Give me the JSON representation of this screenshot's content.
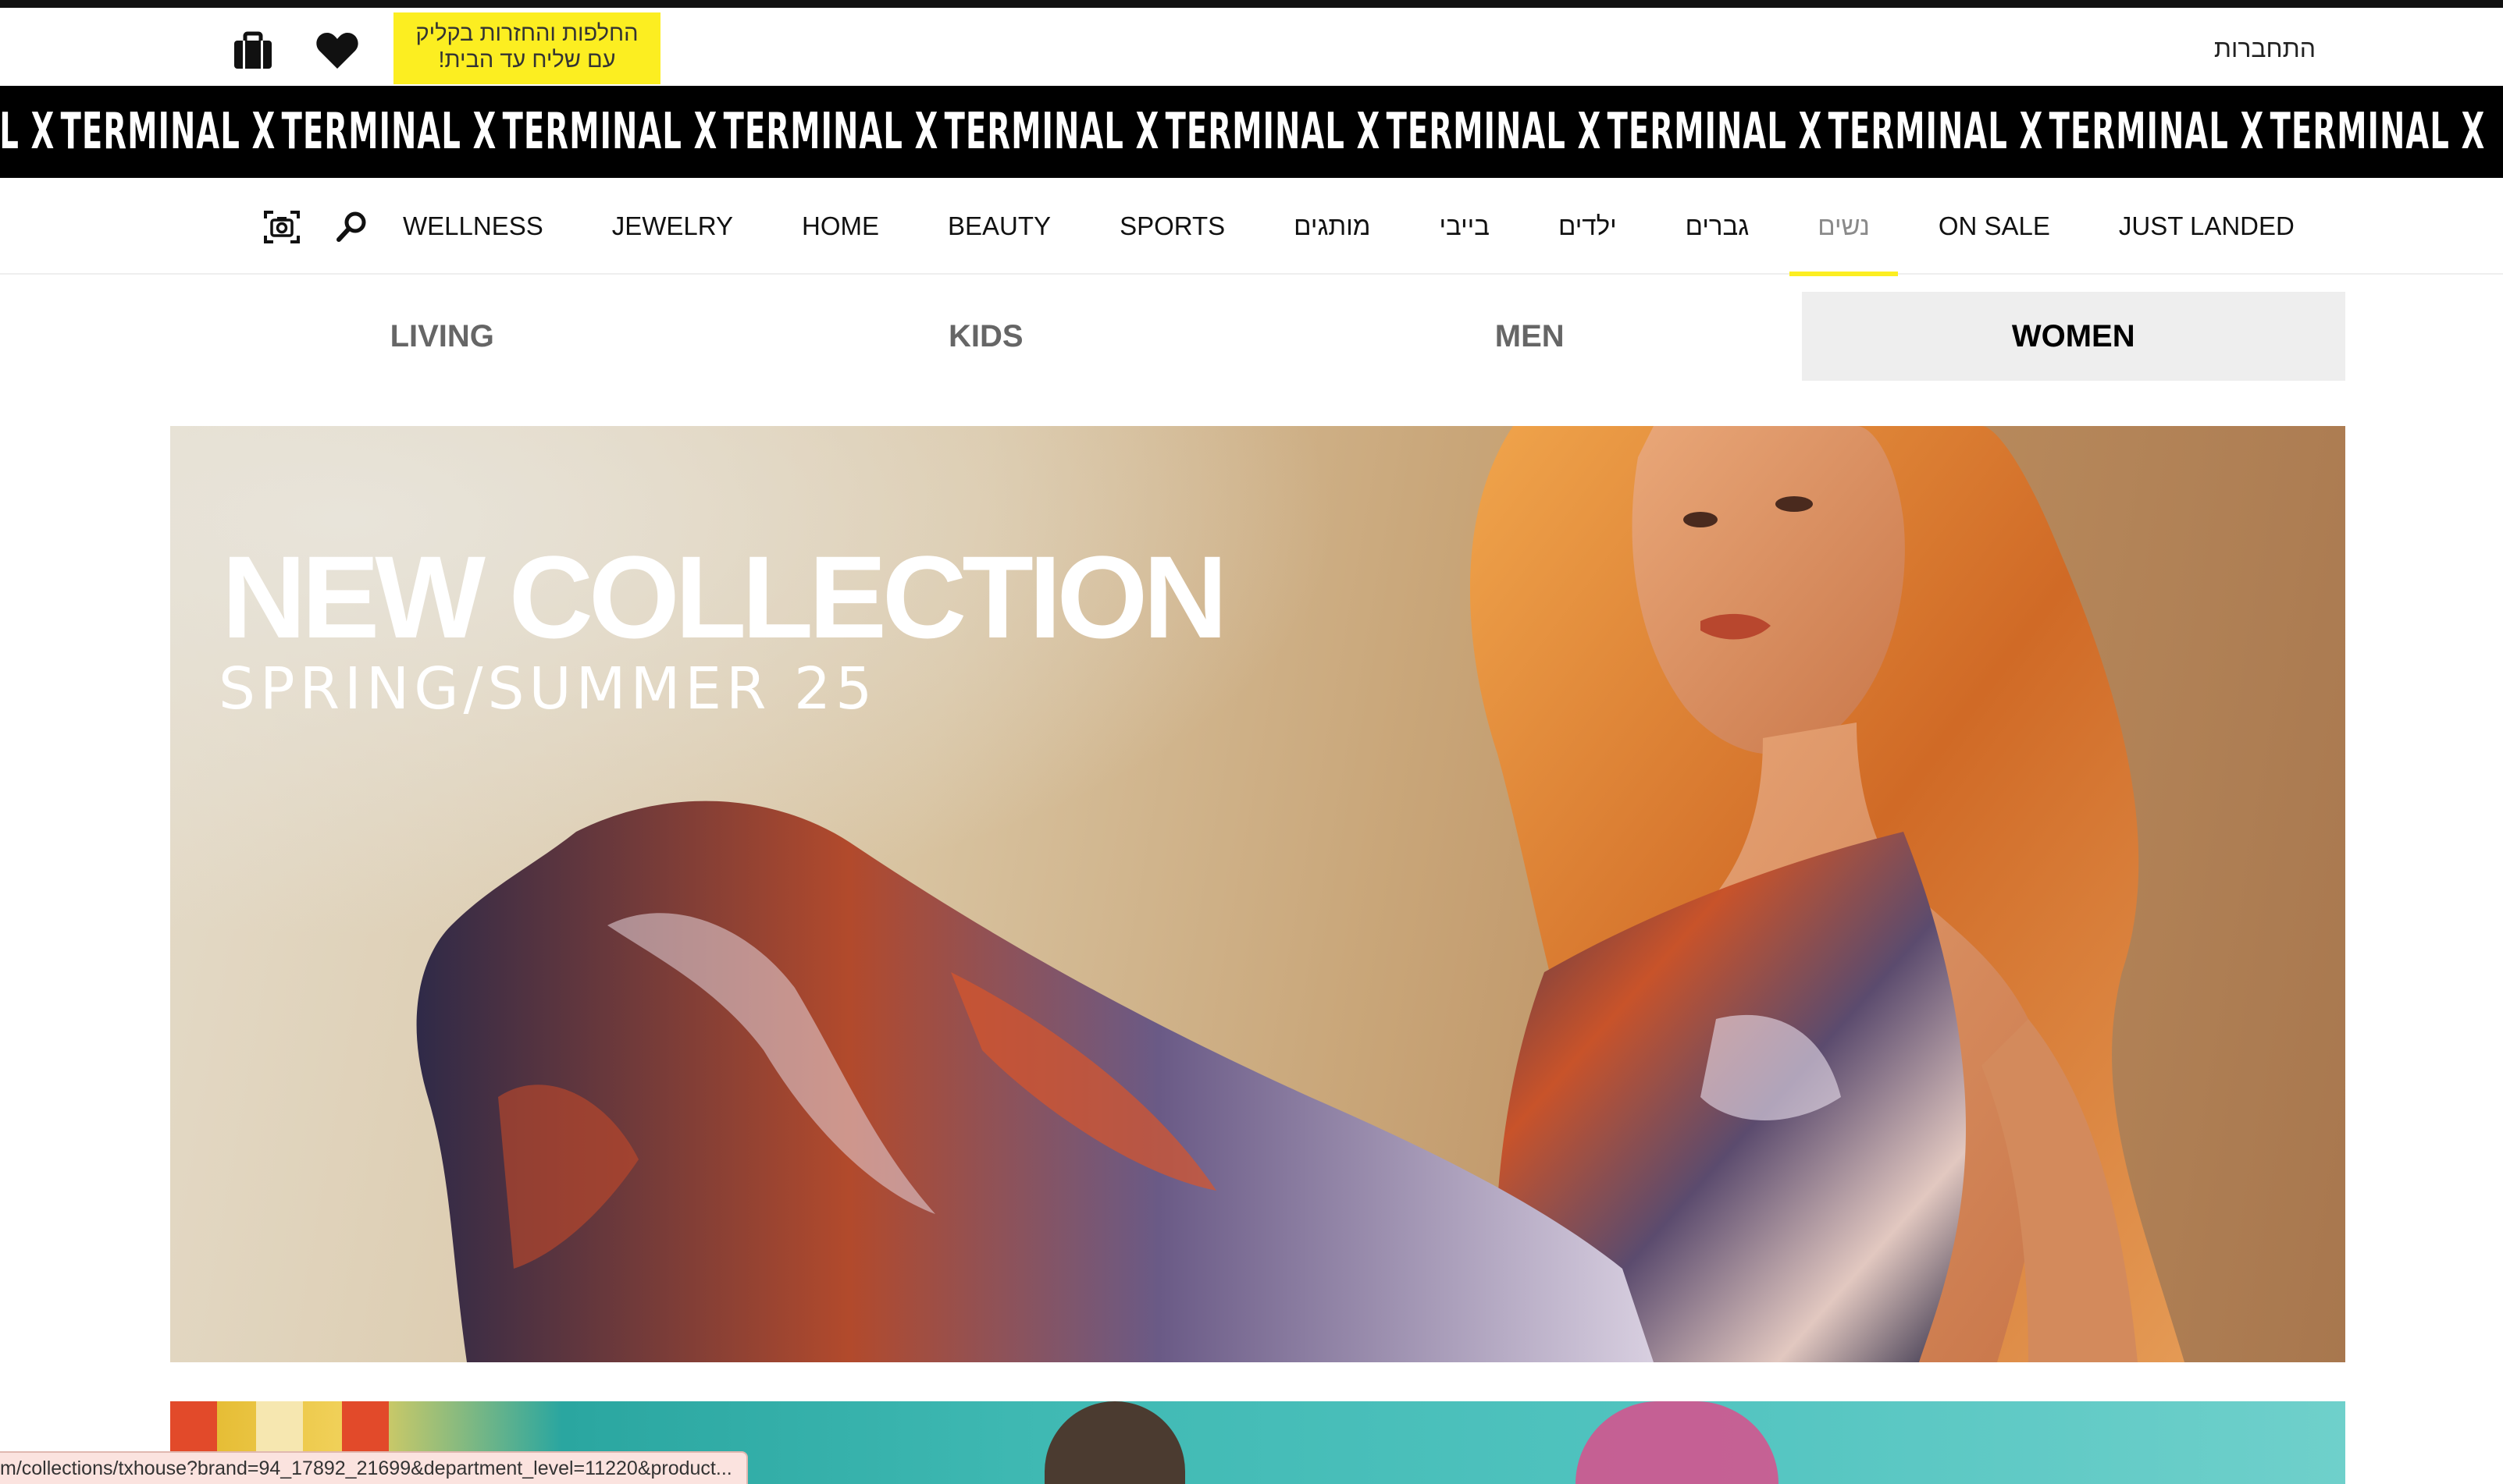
{
  "utility": {
    "promo_line1": "החלפות והחזרות בקליק",
    "promo_line2": "עם שליח עד הבית!",
    "login": "התחברות"
  },
  "brand": {
    "logo_text": "TERMINAL X",
    "repeat_count": 12
  },
  "mainnav": {
    "tools": [
      "camera-search-icon",
      "search-icon"
    ],
    "items": [
      {
        "label": "WELLNESS"
      },
      {
        "label": "JEWELRY"
      },
      {
        "label": "HOME"
      },
      {
        "label": "BEAUTY"
      },
      {
        "label": "SPORTS"
      },
      {
        "label": "מותגים"
      },
      {
        "label": "בייבי"
      },
      {
        "label": "ילדים"
      },
      {
        "label": "גברים"
      },
      {
        "label": "נשים",
        "active": true
      },
      {
        "label": "ON SALE"
      },
      {
        "label": "JUST LANDED"
      }
    ]
  },
  "dept_tabs": [
    {
      "label": "LIVING"
    },
    {
      "label": "KIDS"
    },
    {
      "label": "MEN"
    },
    {
      "label": "WOMEN",
      "active": true
    }
  ],
  "hero": {
    "title": "NEW COLLECTION",
    "subtitle": "SPRING/SUMMER 25"
  },
  "status_url": "m/collections/txhouse?brand=94_17892_21699&department_level=11220&product...",
  "colors": {
    "accent_yellow": "#fcee21",
    "marquee_bg": "#000000",
    "active_tab_bg": "#eeeeee"
  }
}
